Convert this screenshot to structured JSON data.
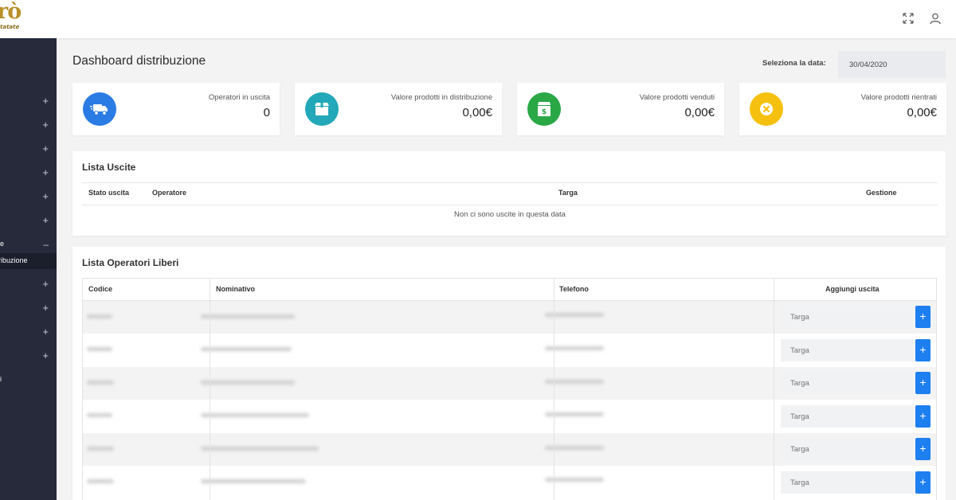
{
  "brand": {
    "logo_text": "rò",
    "logo_subtext": "tatate"
  },
  "topbar": {
    "fullscreen_icon": "expand-arrows-icon",
    "user_icon": "user-icon"
  },
  "sidebar": {
    "items": [
      {
        "label": "",
        "toggle": "+"
      },
      {
        "label": "",
        "toggle": "+"
      },
      {
        "label": "",
        "toggle": "+"
      },
      {
        "label": "",
        "toggle": "+"
      },
      {
        "label": "",
        "toggle": "+"
      },
      {
        "label": "",
        "toggle": "+"
      },
      {
        "label": "e",
        "toggle": "–"
      },
      {
        "label": "",
        "toggle": "+"
      },
      {
        "label": "",
        "toggle": "+"
      },
      {
        "label": "",
        "toggle": "+"
      },
      {
        "label": "",
        "toggle": "+"
      }
    ],
    "active_sub": "ribuzione",
    "bottom_item": "i"
  },
  "header": {
    "title": "Dashboard distribuzione",
    "date_label": "Seleziona la data:",
    "date_value": "30/04/2020"
  },
  "cards": [
    {
      "label": "Operatori in uscita",
      "value": "0",
      "icon": "delivery-truck-icon",
      "color": "#2b7be4"
    },
    {
      "label": "Valore prodotti in distribuzione",
      "value": "0,00€",
      "icon": "box-icon",
      "color": "#22a8b8"
    },
    {
      "label": "Valore prodotti venduti",
      "value": "0,00€",
      "icon": "money-box-icon",
      "color": "#2aa846"
    },
    {
      "label": "Valore prodotti rientrati",
      "value": "0,00€",
      "icon": "close-circle-icon",
      "color": "#f5c10e"
    }
  ],
  "uscite": {
    "title": "Lista Uscite",
    "columns": [
      "Stato uscita",
      "Operatore",
      "Targa",
      "Gestione"
    ],
    "empty_message": "Non ci sono uscite in questa data"
  },
  "operatori": {
    "title": "Lista Operatori Liberi",
    "columns": [
      "Codice",
      "Nominativo",
      "Telefono",
      "Aggiungi uscita"
    ],
    "targa_placeholder": "Targa",
    "add_label": "+",
    "row_count": 6
  }
}
